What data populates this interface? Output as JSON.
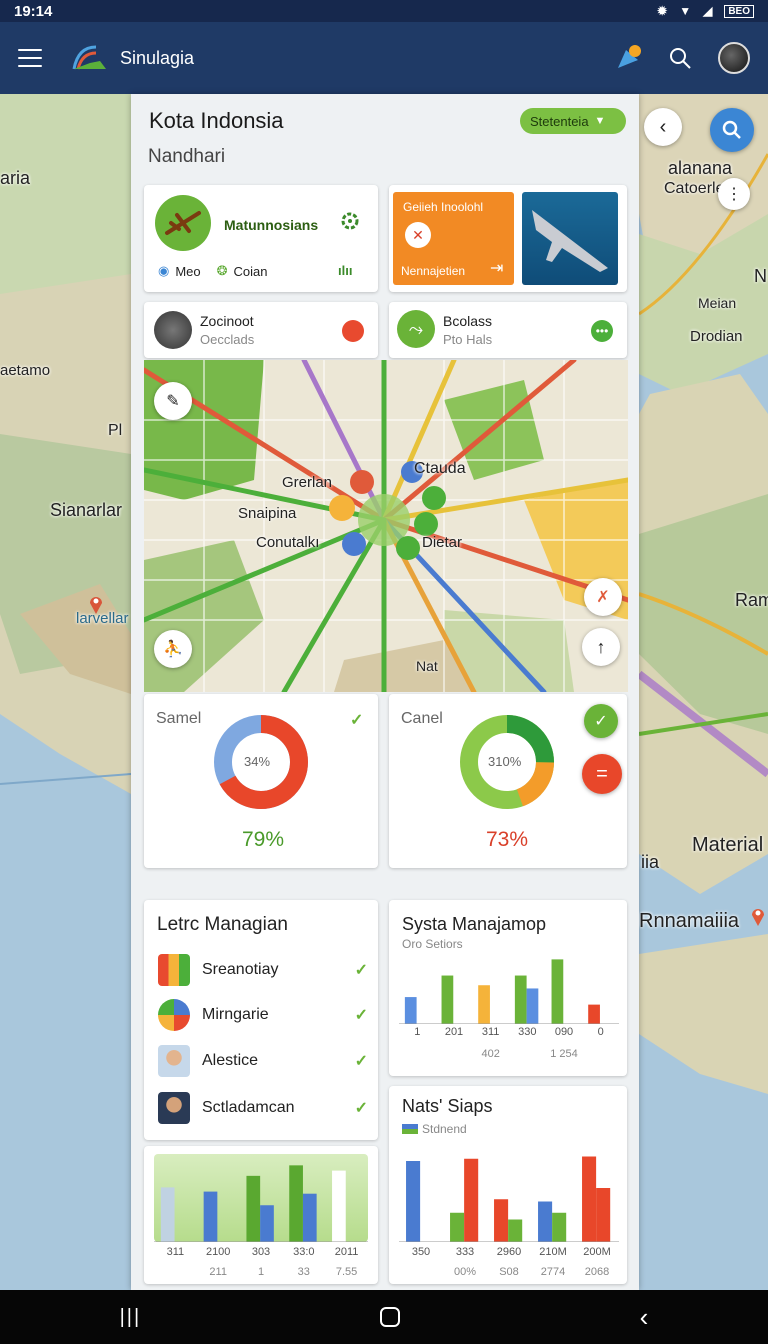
{
  "status": {
    "time": "19:14",
    "battery": "BEO"
  },
  "app": {
    "title": "Sinulagia"
  },
  "panel": {
    "title": "Kota Indonsia",
    "subtitle": "Nandhari",
    "filter_label": "Stetenteia"
  },
  "top_cards": {
    "card1": {
      "title": "Matunnosians",
      "meta1": "Meo",
      "meta2": "Coian",
      "meta3": "ılıı"
    },
    "card2": {
      "title": "Geiieh Inoolohl",
      "footer": "Nennajetien"
    },
    "card3": {
      "title": "Zocinoot",
      "sub": "Oecclads"
    },
    "card4": {
      "title": "Bcolass",
      "sub": "Pto Hals"
    }
  },
  "inner_map": {
    "labels": [
      "Grerlan",
      "Ctauda",
      "Snaipina",
      "Conutalkı",
      "Dietar",
      "Nat"
    ]
  },
  "map_labels": [
    "aria",
    "alanana",
    "Catoerle",
    "Meian",
    "N",
    "Drodian",
    "aetamo",
    "Pl",
    "Sianarlar",
    "larvellar",
    "Ram",
    "Material",
    "iia",
    "Rnnamaiiia"
  ],
  "donuts": {
    "left": {
      "title": "Samel",
      "inner": "34%",
      "value": "79%"
    },
    "right": {
      "title": "Canel",
      "inner": "310%",
      "value": "73%"
    }
  },
  "list_card": {
    "title": "Letrc Managian",
    "items": [
      "Sreanotiay",
      "Mirngarie",
      "Alestice",
      "Sctladamcan"
    ]
  },
  "chart_card1": {
    "title": "Systa Manajamop",
    "subtitle": "Oro Setiors",
    "xlabels": [
      "1",
      "201",
      "311",
      "330",
      "090",
      "0"
    ],
    "footer": [
      "",
      "",
      "402",
      "",
      "1 254",
      ""
    ]
  },
  "chart_card2": {
    "title": "Nats' Siaps",
    "legend": "Stdnend",
    "xlabels": [
      "350",
      "333",
      "2960",
      "210M",
      "200M"
    ],
    "footer": [
      "",
      "00%",
      "S08",
      "2774",
      "2068"
    ]
  },
  "chart_card3": {
    "xlabels": [
      "311",
      "2100",
      "303",
      "33:0",
      "2011"
    ],
    "footer": [
      "",
      "211",
      "1",
      "33",
      "7.55"
    ]
  },
  "chart_data": [
    {
      "type": "bar",
      "title": "Systa Manajamop",
      "categories": [
        "1",
        "201",
        "311",
        "330",
        "090",
        "0"
      ],
      "series": [
        {
          "values": [
            25,
            45,
            36,
            45,
            60,
            18
          ]
        },
        {
          "values": [
            0,
            0,
            0,
            33,
            0,
            0
          ]
        }
      ]
    },
    {
      "type": "bar",
      "title": "Nats' Siaps",
      "categories": [
        "350",
        "333",
        "2960",
        "210M",
        "200M"
      ],
      "series": [
        {
          "values": [
            72,
            26,
            38,
            36,
            76
          ]
        },
        {
          "values": [
            0,
            74,
            20,
            26,
            48
          ]
        }
      ]
    },
    {
      "type": "bar",
      "categories": [
        "311",
        "2100",
        "303",
        "33:0",
        "2011"
      ],
      "series": [
        {
          "values": [
            52,
            48,
            63,
            73,
            68
          ]
        },
        {
          "values": [
            0,
            0,
            35,
            46,
            0
          ]
        }
      ]
    }
  ],
  "colors": {
    "app_bar": "#1f3a66",
    "accent_green": "#6ab338",
    "accent_red": "#e84a2f",
    "accent_blue": "#4a7bd0",
    "accent_orange": "#f39c2a"
  }
}
